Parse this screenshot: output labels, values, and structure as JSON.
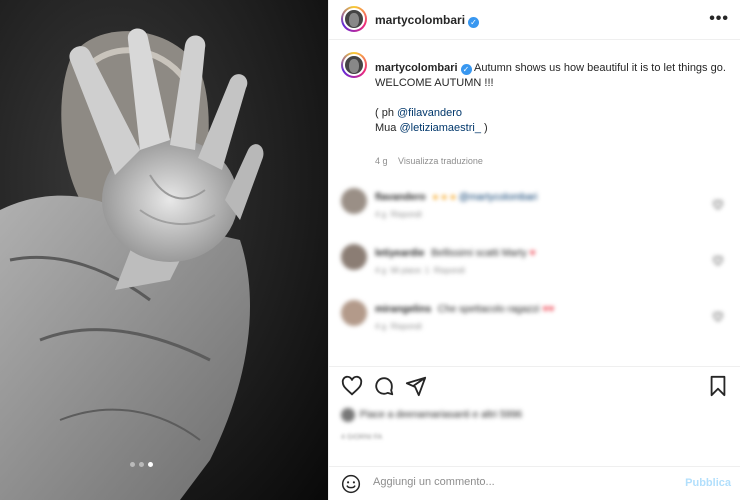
{
  "post": {
    "username": "martycolombari",
    "verified_icon": "verified-badge-icon",
    "more_icon": "more-options-icon",
    "caption": {
      "username": "martycolombari",
      "line1": "Autumn shows us how beautiful it is to let things go.",
      "line2": "WELCOME AUTUMN !!!",
      "credit_prefix": "( ph ",
      "credit_mention": "@filavandero",
      "mua_prefix": "Mua ",
      "mua_mention": "@letiziamaestri_",
      "mua_suffix": " )",
      "age": "4 g",
      "translate": "Visualizza traduzione"
    },
    "carousel": {
      "slides": 3,
      "active": 3
    },
    "comments": [
      {
        "user": "flavandero",
        "text": "",
        "mention": "@martycolombari",
        "emoji": "● ● ●",
        "time": "4 g",
        "reply": "Rispondi",
        "likes": ""
      },
      {
        "user": "letiyeardie",
        "text": "Bellissimi scatti Marty",
        "emoji": "♥",
        "time": "4 g",
        "likes": "Mi piace: 1",
        "reply": "Rispondi",
        "mention": ""
      },
      {
        "user": "mirangelins",
        "text": "Che spettacolo ragazzi",
        "emoji": "♥♥",
        "time": "4 g",
        "reply": "Rispondi",
        "likes": "",
        "mention": ""
      }
    ],
    "likes_text": "Piace a deenamariasanti e altri 5996",
    "date": "4 GIORNI FA",
    "add_comment": {
      "placeholder": "Aggiungi un commento...",
      "publish_label": "Pubblica"
    },
    "colors": {
      "link": "#00376b",
      "verified": "#3897f0",
      "publish_disabled": "#b2dffc",
      "heart": "#ed4956"
    }
  }
}
